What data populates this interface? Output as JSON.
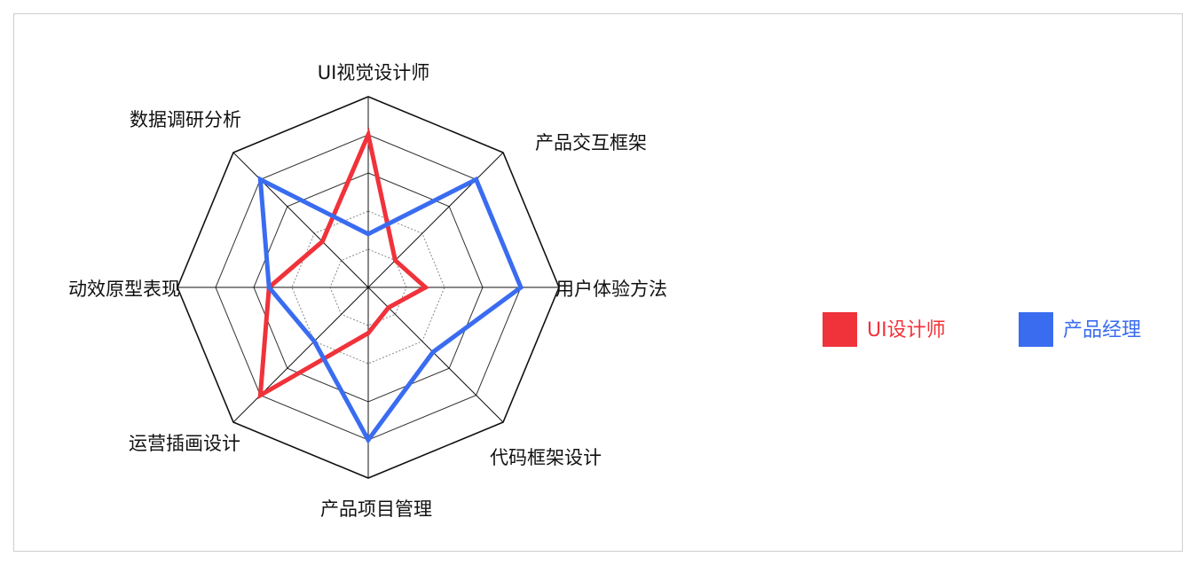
{
  "chart_data": {
    "type": "radar",
    "axes": [
      "UI视觉设计师",
      "产品交互框架",
      "用户体验方法",
      "代码框架设计",
      "产品项目管理",
      "运营插画设计",
      "动效原型表现",
      "数据调研分析"
    ],
    "rings": 5,
    "max": 5,
    "series": [
      {
        "name": "UI设计师",
        "color": "#f0323a",
        "values": [
          4,
          1.0,
          1.5,
          0.75,
          1.2,
          4,
          2.6,
          1.7
        ]
      },
      {
        "name": "产品经理",
        "color": "#3a6cf0",
        "values": [
          1.4,
          4,
          4,
          2.4,
          4,
          2.0,
          2.6,
          4
        ]
      }
    ],
    "legend_position": "right"
  },
  "legend": {
    "items": [
      {
        "label": "UI设计师",
        "color": "#f0323a"
      },
      {
        "label": "产品经理",
        "color": "#3a6cf0"
      }
    ]
  }
}
